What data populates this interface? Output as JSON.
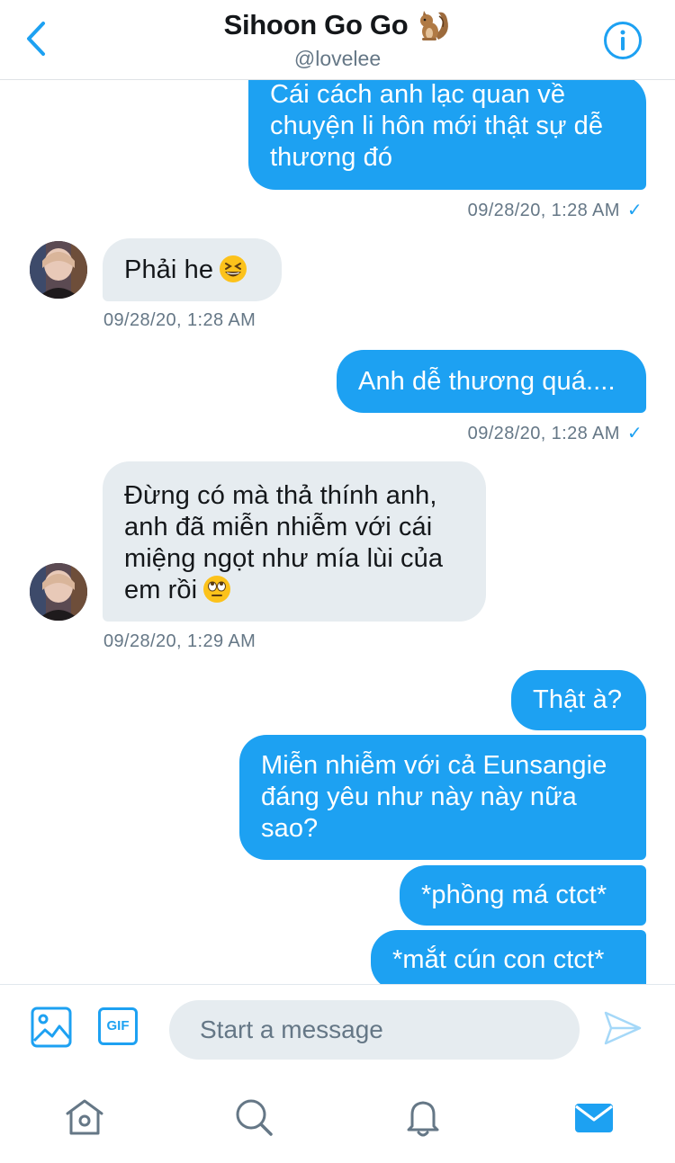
{
  "header": {
    "title": "Sihoon Go Go",
    "handle": "@lovelee"
  },
  "messages": [
    {
      "side": "sent",
      "text": "Cái cách anh lạc quan về chuyện li hôn mới thật sự dễ thương đó",
      "lines": [
        "Cái cách anh lạc quan về",
        "chuyện li hôn mới thật sự dễ",
        "thương đó"
      ],
      "timestamp": "09/28/20, 1:28 AM",
      "read_mark": "✓"
    },
    {
      "side": "received",
      "text": "Phải he",
      "emoji": "grinning-squinting-face-emoji",
      "timestamp": "09/28/20, 1:28 AM"
    },
    {
      "side": "sent",
      "text": "Anh dễ thương quá....",
      "timestamp": "09/28/20, 1:28 AM",
      "read_mark": "✓"
    },
    {
      "side": "received",
      "lines": [
        "Đừng có mà thả thính anh,",
        "anh đã miễn nhiễm với cái",
        "miệng ngọt như mía lùi của",
        "em rồi"
      ],
      "emoji": "face-with-rolling-eyes-emoji",
      "timestamp": "09/28/20, 1:29 AM"
    },
    {
      "side": "sent",
      "text": "Thật à?"
    },
    {
      "side": "sent",
      "lines": [
        "Miễn nhiễm với cả Eunsangie",
        "đáng yêu như này này nữa",
        "sao?"
      ]
    },
    {
      "side": "sent",
      "text": "*phồng má ctct*"
    },
    {
      "side": "sent",
      "text": "*mắt cún con ctct*"
    }
  ],
  "composer": {
    "placeholder": "Start a message",
    "gif_label": "GIF"
  },
  "colors": {
    "accent": "#1da1f2",
    "received_bubble": "#e6ecf0",
    "timestamp": "#657786",
    "text": "#14171a"
  },
  "tabs": [
    "home-icon",
    "search-icon",
    "notifications-icon",
    "messages-icon"
  ]
}
